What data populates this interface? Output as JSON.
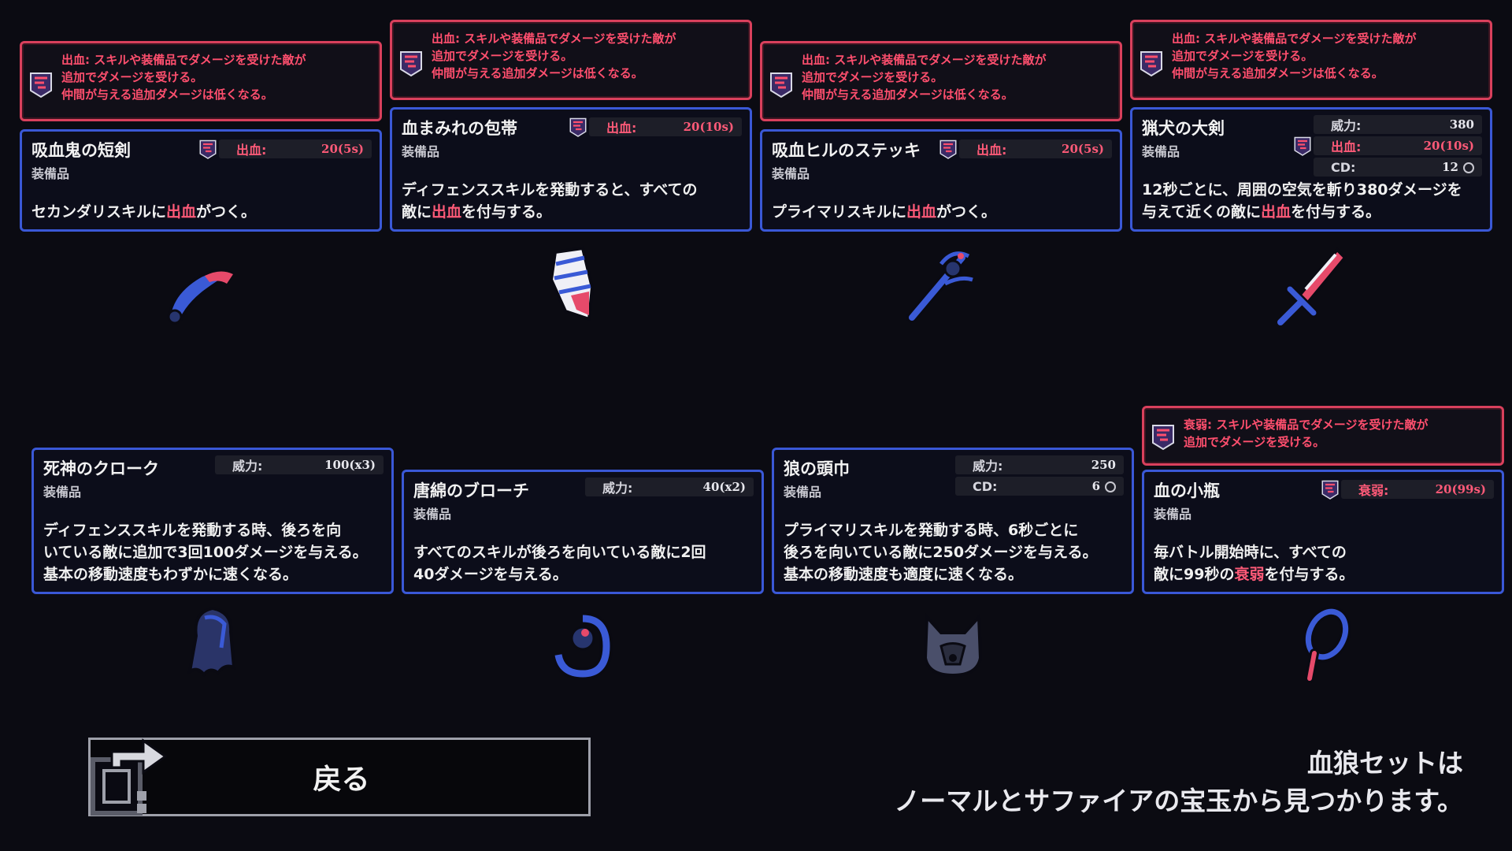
{
  "colors": {
    "accent_red": "#ff4f6e",
    "card_border": "#3a58d6",
    "tooltip_border": "#d9405c",
    "background": "#0b0b12"
  },
  "tooltips": {
    "bleed": {
      "name": "出血",
      "line1": "出血: スキルや装備品でダメージを受けた敵が",
      "line2": "追加でダメージを受ける。",
      "line3": "仲間が与える追加ダメージは低くなる。"
    },
    "weaken": {
      "line1": "衰弱: スキルや装備品でダメージを受けた敵が",
      "line2": "追加でダメージを受ける。"
    }
  },
  "items": [
    {
      "name": "吸血鬼の短剣",
      "type": "装備品",
      "stat1_label": "出血:",
      "stat1_value": "20(5s)",
      "desc_pre": "セカンダリスキルに",
      "desc_hl": "出血",
      "desc_post": "がつく。",
      "icon": "dagger-icon"
    },
    {
      "name": "血まみれの包帯",
      "type": "装備品",
      "stat1_label": "出血:",
      "stat1_value": "20(10s)",
      "desc_line1": "ディフェンススキルを発動すると、すべての",
      "desc_pre": "敵に",
      "desc_hl": "出血",
      "desc_post": "を付与する。",
      "icon": "bandage-icon"
    },
    {
      "name": "吸血ヒルのステッキ",
      "type": "装備品",
      "stat1_label": "出血:",
      "stat1_value": "20(5s)",
      "desc_pre": "プライマリスキルに",
      "desc_hl": "出血",
      "desc_post": "がつく。",
      "icon": "staff-icon"
    },
    {
      "name": "猟犬の大剣",
      "type": "装備品",
      "stat1_label": "威力:",
      "stat1_value": "380",
      "stat2_label": "出血:",
      "stat2_value": "20(10s)",
      "stat3_label": "CD:",
      "stat3_value": "12",
      "desc_line1": "12秒ごとに、周囲の空気を斬り380ダメージを",
      "desc_pre": "与えて近くの敵に",
      "desc_hl": "出血",
      "desc_post": "を付与する。",
      "icon": "greatsword-icon"
    },
    {
      "name": "死神のクローク",
      "type": "装備品",
      "stat1_label": "威力:",
      "stat1_value": "100(x3)",
      "desc_line1": "ディフェンススキルを発動する時、後ろを向",
      "desc_line2": "いている敵に追加で3回100ダメージを与える。",
      "desc_line3": "基本の移動速度もわずかに速くなる。",
      "icon": "cloak-icon"
    },
    {
      "name": "唐綿のブローチ",
      "type": "装備品",
      "stat1_label": "威力:",
      "stat1_value": "40(x2)",
      "desc_line1": "すべてのスキルが後ろを向いている敵に2回",
      "desc_line2": "40ダメージを与える。",
      "icon": "brooch-icon"
    },
    {
      "name": "狼の頭巾",
      "type": "装備品",
      "stat1_label": "威力:",
      "stat1_value": "250",
      "stat2_label": "CD:",
      "stat2_value": "6",
      "desc_line1": "プライマリスキルを発動する時、6秒ごとに",
      "desc_line2": "後ろを向いている敵に250ダメージを与える。",
      "desc_line3": "基本の移動速度も適度に速くなる。",
      "icon": "wolf-hood-icon"
    },
    {
      "name": "血の小瓶",
      "type": "装備品",
      "stat1_label": "衰弱:",
      "stat1_value": "20(99s)",
      "desc_line1": "毎バトル開始時に、すべての",
      "desc_pre": "敵に99秒の",
      "desc_hl": "衰弱",
      "desc_post": "を付与する。",
      "icon": "vial-icon"
    }
  ],
  "back_button": {
    "label": "戻る"
  },
  "footer": {
    "line1": "血狼セットは",
    "line2": "ノーマルとサファイアの宝玉から見つかります。"
  }
}
